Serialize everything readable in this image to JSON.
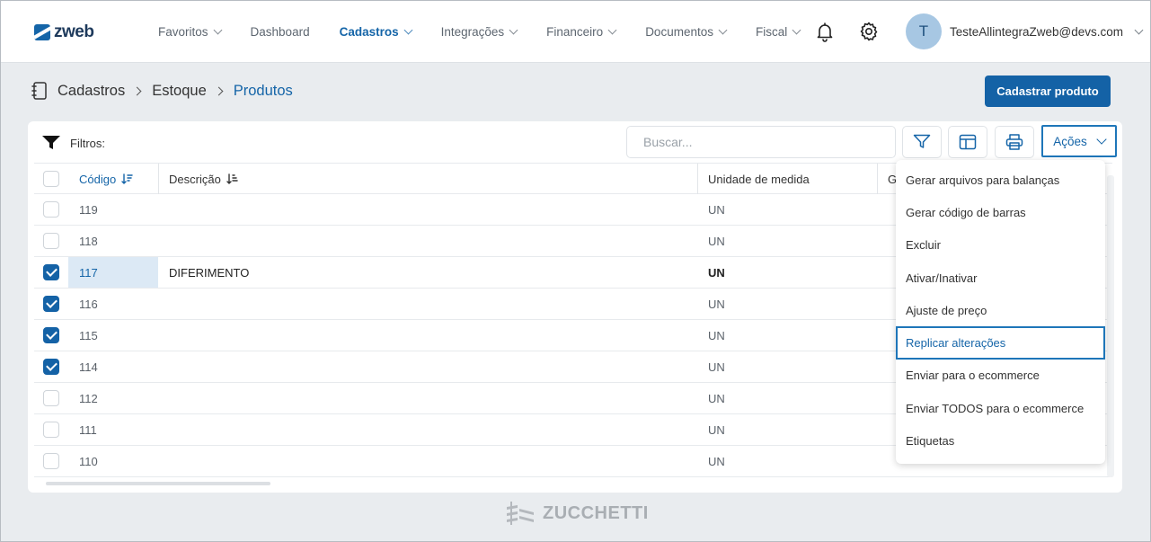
{
  "brand": {
    "name": "zweb"
  },
  "nav": {
    "items": [
      {
        "label": "Favoritos",
        "has_chevron": true,
        "active": false
      },
      {
        "label": "Dashboard",
        "has_chevron": false,
        "active": false
      },
      {
        "label": "Cadastros",
        "has_chevron": true,
        "active": true
      },
      {
        "label": "Integrações",
        "has_chevron": true,
        "active": false
      },
      {
        "label": "Financeiro",
        "has_chevron": true,
        "active": false
      },
      {
        "label": "Documentos",
        "has_chevron": true,
        "active": false
      },
      {
        "label": "Fiscal",
        "has_chevron": true,
        "active": false
      }
    ],
    "icons": [
      "bell-icon",
      "gear-icon"
    ]
  },
  "user": {
    "initial": "T",
    "email": "TesteAllintegraZweb@devs.com"
  },
  "breadcrumb": {
    "items": [
      "Cadastros",
      "Estoque",
      "Produtos"
    ]
  },
  "actions": {
    "primary_label": "Cadastrar produto"
  },
  "toolbar": {
    "filters_label": "Filtros:",
    "search_placeholder": "Buscar...",
    "acoes_label": "Ações"
  },
  "table": {
    "headers": {
      "code": "Código",
      "description": "Descrição",
      "unit": "Unidade de medida",
      "g": "G"
    },
    "rows": [
      {
        "code": "119",
        "description": "",
        "unit": "UN",
        "checked": false,
        "selected": false
      },
      {
        "code": "118",
        "description": "",
        "unit": "UN",
        "checked": false,
        "selected": false
      },
      {
        "code": "117",
        "description": "DIFERIMENTO",
        "unit": "UN",
        "checked": true,
        "selected": true
      },
      {
        "code": "116",
        "description": "",
        "unit": "UN",
        "checked": true,
        "selected": false
      },
      {
        "code": "115",
        "description": "",
        "unit": "UN",
        "checked": true,
        "selected": false
      },
      {
        "code": "114",
        "description": "",
        "unit": "UN",
        "checked": true,
        "selected": false
      },
      {
        "code": "112",
        "description": "",
        "unit": "UN",
        "checked": false,
        "selected": false
      },
      {
        "code": "111",
        "description": "",
        "unit": "UN",
        "checked": false,
        "selected": false
      },
      {
        "code": "110",
        "description": "",
        "unit": "UN",
        "checked": false,
        "selected": false
      }
    ]
  },
  "dropdown": {
    "items": [
      "Gerar arquivos para balanças",
      "Gerar código de barras",
      "Excluir",
      "Ativar/Inativar",
      "Ajuste de preço",
      "Replicar alterações",
      "Enviar para o ecommerce",
      "Enviar TODOS para o ecommerce",
      "Etiquetas"
    ],
    "highlighted_index": 5
  },
  "footer": {
    "brand": "ZUCCHETTI"
  },
  "colors": {
    "accent": "#1462a6",
    "link": "#1565a8",
    "highlight_border": "#1e76b9",
    "selected_cell": "#dce9f5"
  }
}
